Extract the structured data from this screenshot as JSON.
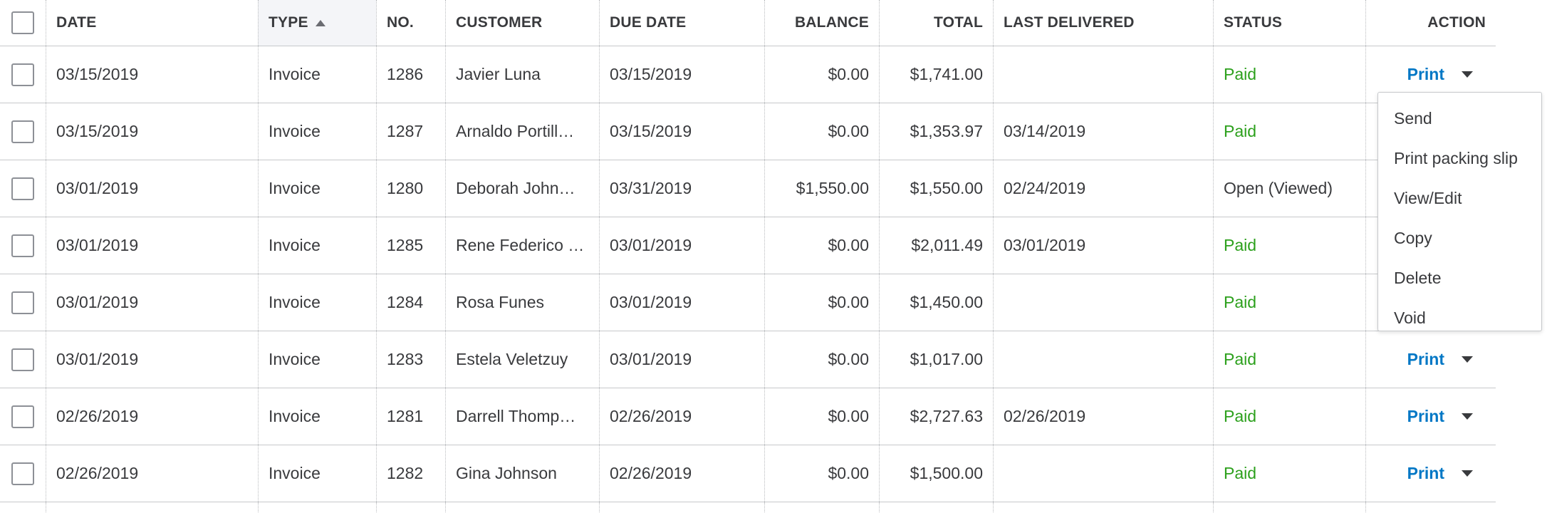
{
  "table": {
    "headers": {
      "date": "DATE",
      "type": "TYPE",
      "no": "NO.",
      "customer": "CUSTOMER",
      "due_date": "DUE DATE",
      "balance": "BALANCE",
      "total": "TOTAL",
      "last_delivered": "LAST DELIVERED",
      "status": "STATUS",
      "action": "ACTION"
    },
    "rows": [
      {
        "date": "03/15/2019",
        "type": "Invoice",
        "no": "1286",
        "customer": "Javier Luna",
        "due_date": "03/15/2019",
        "balance": "$0.00",
        "total": "$1,741.00",
        "last_delivered": "",
        "status": "Paid",
        "action": "Print"
      },
      {
        "date": "03/15/2019",
        "type": "Invoice",
        "no": "1287",
        "customer": "Arnaldo Portill…",
        "due_date": "03/15/2019",
        "balance": "$0.00",
        "total": "$1,353.97",
        "last_delivered": "03/14/2019",
        "status": "Paid",
        "action": ""
      },
      {
        "date": "03/01/2019",
        "type": "Invoice",
        "no": "1280",
        "customer": "Deborah John…",
        "due_date": "03/31/2019",
        "balance": "$1,550.00",
        "total": "$1,550.00",
        "last_delivered": "02/24/2019",
        "status": "Open (Viewed)",
        "action": ""
      },
      {
        "date": "03/01/2019",
        "type": "Invoice",
        "no": "1285",
        "customer": "Rene Federico …",
        "due_date": "03/01/2019",
        "balance": "$0.00",
        "total": "$2,011.49",
        "last_delivered": "03/01/2019",
        "status": "Paid",
        "action": ""
      },
      {
        "date": "03/01/2019",
        "type": "Invoice",
        "no": "1284",
        "customer": "Rosa Funes",
        "due_date": "03/01/2019",
        "balance": "$0.00",
        "total": "$1,450.00",
        "last_delivered": "",
        "status": "Paid",
        "action": ""
      },
      {
        "date": "03/01/2019",
        "type": "Invoice",
        "no": "1283",
        "customer": "Estela Veletzuy",
        "due_date": "03/01/2019",
        "balance": "$0.00",
        "total": "$1,017.00",
        "last_delivered": "",
        "status": "Paid",
        "action": "Print"
      },
      {
        "date": "02/26/2019",
        "type": "Invoice",
        "no": "1281",
        "customer": "Darrell Thomp…",
        "due_date": "02/26/2019",
        "balance": "$0.00",
        "total": "$2,727.63",
        "last_delivered": "02/26/2019",
        "status": "Paid",
        "action": "Print"
      },
      {
        "date": "02/26/2019",
        "type": "Invoice",
        "no": "1282",
        "customer": "Gina Johnson",
        "due_date": "02/26/2019",
        "balance": "$0.00",
        "total": "$1,500.00",
        "last_delivered": "",
        "status": "Paid",
        "action": "Print"
      }
    ]
  },
  "action_menu": {
    "items": [
      "Send",
      "Print packing slip",
      "View/Edit",
      "Copy",
      "Delete",
      "Void"
    ]
  },
  "colors": {
    "paid": "#2ca01c",
    "link": "#0077c5",
    "text": "#393a3d",
    "sorted_header_bg": "#f4f5f8"
  },
  "icons": {
    "sort": "sort-ascending-icon",
    "dropdown": "chevron-down-icon"
  }
}
